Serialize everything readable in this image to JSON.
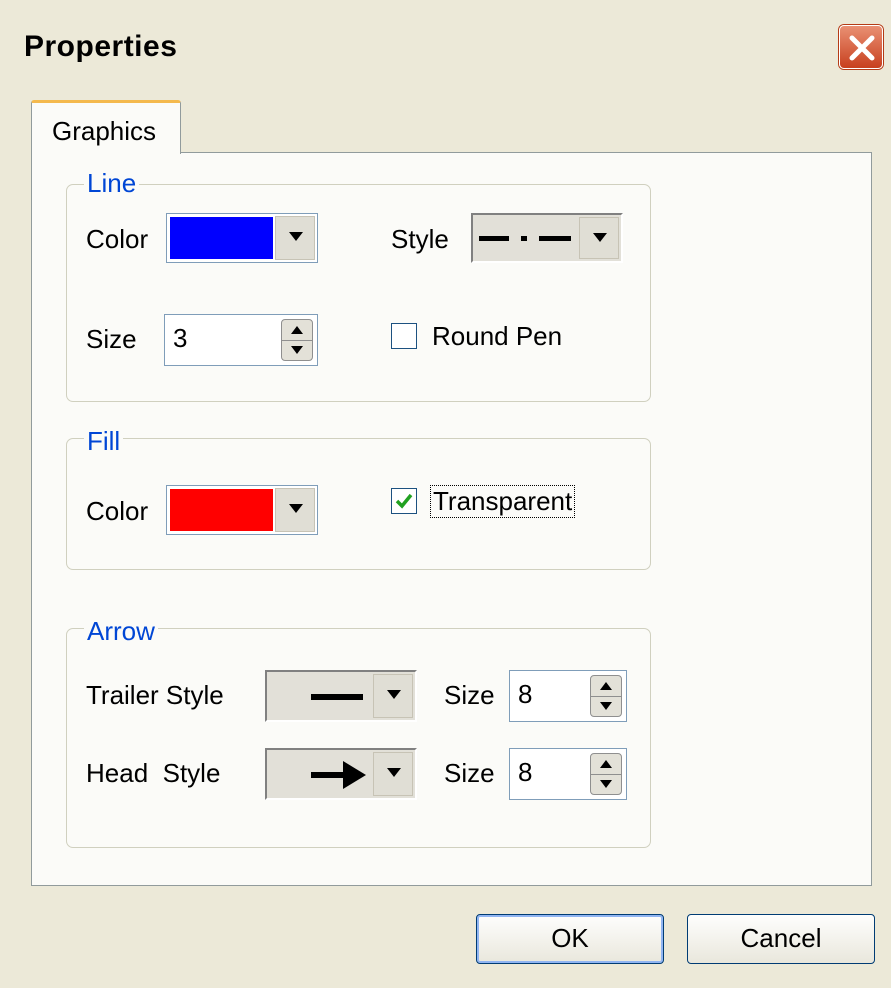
{
  "window": {
    "title": "Properties"
  },
  "tabs": [
    {
      "label": "Graphics"
    }
  ],
  "line_group": {
    "legend": "Line",
    "color_label": "Color",
    "color_value": "#0000ff",
    "style_label": "Style",
    "size_label": "Size",
    "size_value": "3",
    "round_pen_label": "Round Pen",
    "round_pen_checked": false
  },
  "fill_group": {
    "legend": "Fill",
    "color_label": "Color",
    "color_value": "#ff0000",
    "transparent_label": "Transparent",
    "transparent_checked": true
  },
  "arrow_group": {
    "legend": "Arrow",
    "trailer_style_label": "Trailer Style",
    "trailer_size_label": "Size",
    "trailer_size_value": "8",
    "head_style_label": "Head  Style",
    "head_size_label": "Size",
    "head_size_value": "8"
  },
  "buttons": {
    "ok": "OK",
    "cancel": "Cancel"
  }
}
